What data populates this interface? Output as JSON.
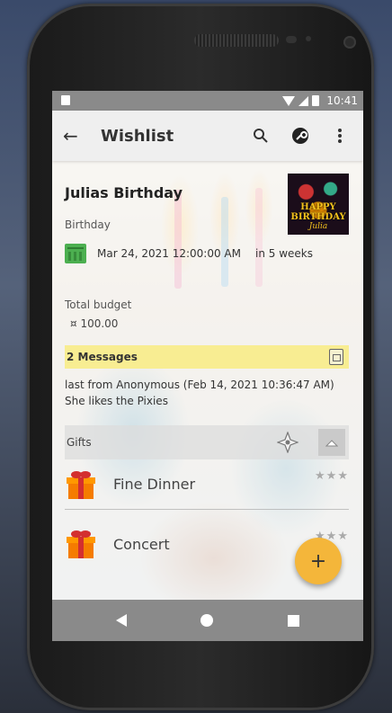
{
  "status_bar": {
    "time": "10:41"
  },
  "app_bar": {
    "title": "Wishlist"
  },
  "event": {
    "title": "Julias Birthday",
    "category": "Birthday",
    "date": "Mar 24, 2021 12:00:00 AM",
    "relative": "in 5 weeks",
    "thumbnail_text": [
      "HAPPY",
      "BIRTHDAY",
      "Julia"
    ],
    "budget_label": "Total budget",
    "budget_value": "¤ 100.00"
  },
  "messages": {
    "header": "2 Messages",
    "last_from": "last from Anonymous (Feb 14, 2021 10:36:47 AM)",
    "text": "She likes the Pixies"
  },
  "gifts": {
    "label": "Gifts",
    "items": [
      {
        "name": "Fine Dinner",
        "rating_stars": "★★★"
      },
      {
        "name": "Concert",
        "rating_stars": "★★★"
      }
    ]
  },
  "fab": {
    "icon": "+"
  },
  "colors": {
    "accent": "#f4b63a",
    "messages_bg": "#f8ec8c",
    "calendar": "#4caf50"
  }
}
